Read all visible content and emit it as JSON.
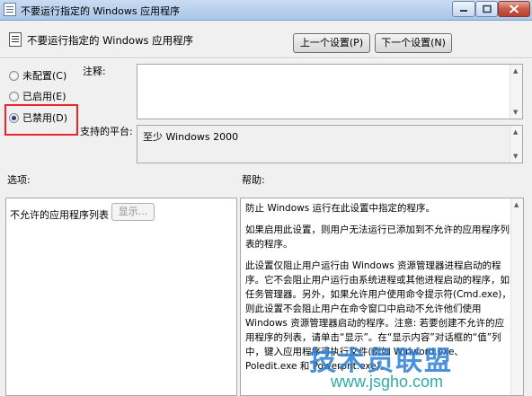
{
  "window": {
    "title": "不要运行指定的 Windows 应用程序"
  },
  "header": {
    "policy_title": "不要运行指定的 Windows 应用程序",
    "prev_button": "上一个设置(P)",
    "next_button": "下一个设置(N)"
  },
  "state": {
    "options": [
      {
        "label": "未配置(C)",
        "selected": false
      },
      {
        "label": "已启用(E)",
        "selected": false
      },
      {
        "label": "已禁用(D)",
        "selected": true
      }
    ],
    "highlight_color": "#e8262b"
  },
  "comment": {
    "label": "注释:",
    "value": ""
  },
  "platform": {
    "label": "支持的平台:",
    "value": "至少 Windows 2000"
  },
  "options_panel": {
    "label": "选项:",
    "list_label": "不允许的应用程序列表",
    "show_button": "显示..."
  },
  "help_panel": {
    "label": "帮助:",
    "paragraphs": [
      "防止 Windows 运行在此设置中指定的程序。",
      "如果启用此设置，则用户无法运行已添加到不允许的应用程序列表的程序。",
      "此设置仅阻止用户运行由 Windows 资源管理器进程启动的程序。它不会阻止用户运行由系统进程或其他进程启动的程序，如任务管理器。另外，如果允许用户使用命令提示符(Cmd.exe)，则此设置不会阻止用户在命令窗口中启动不允许他们使用 Windows 资源管理器启动的程序。注意: 若要创建不允许的应用程序的列表，请单击“显示”。在“显示内容”对话框的“值”列中，键入应用程序可执行文件(例如 Winword.exe、Poledit.exe 和 Powerpnt.exe)。"
    ]
  },
  "watermark": {
    "brand": "技术员联盟",
    "url": "www.jsgho.com"
  }
}
